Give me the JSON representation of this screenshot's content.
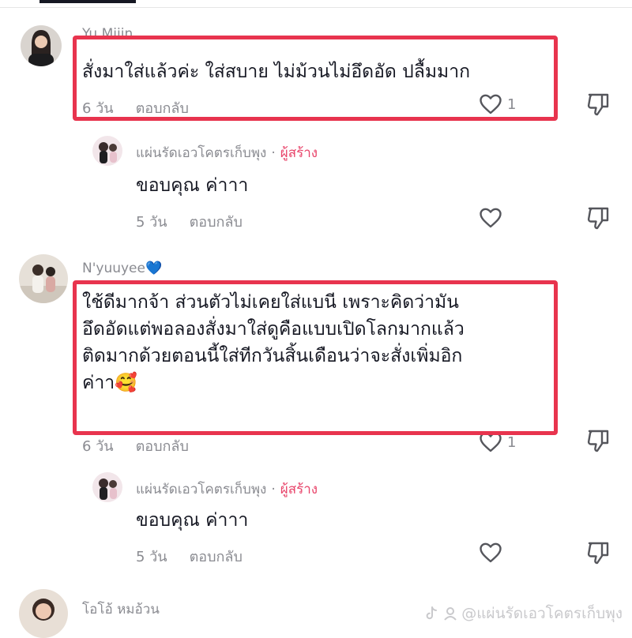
{
  "comments": [
    {
      "username": "Yu Miiin",
      "text_lines": [
        "สั่งมาใส่แล้วค่ะ ใส่สบาย ไม่ม้วนไม่อึดอัด ปลื้มมาก"
      ],
      "time": "6 วัน",
      "reply_label": "ตอบกลับ",
      "like_count": "1",
      "reply": {
        "username": "แผ่นรัดเอวโคตรเก็บพุง",
        "separator": "·",
        "badge": "ผู้สร้าง",
        "text": "ขอบคุณ ค่าาา",
        "time": "5 วัน",
        "reply_label": "ตอบกลับ"
      }
    },
    {
      "username": "N'yuuyee",
      "username_emoji": "💙",
      "text_lines": [
        "ใช้ดีมากจ้า ส่วนตัวไม่เคยใส่แบนี เพราะคิดว่ามัน",
        "อึดอัดแต่พอลองสั่งมาใส่ดูคือแบบเปิดโลกมากแล้ว",
        "ติดมากด้วยตอนนี้ใส่ทีกวันสิ้นเดือนว่าจะสั่งเพิ่มอิก",
        "ค่าา"
      ],
      "text_emoji": "🥰",
      "time": "6 วัน",
      "reply_label": "ตอบกลับ",
      "like_count": "1",
      "reply": {
        "username": "แผ่นรัดเอวโคตรเก็บพุง",
        "separator": "·",
        "badge": "ผู้สร้าง",
        "text": "ขอบคุณ ค่าาา",
        "time": "5 วัน",
        "reply_label": "ตอบกลับ"
      }
    },
    {
      "username": "โอโอ้ หมอ้วน"
    }
  ],
  "watermark": {
    "text": "@แผ่นรัดเอวโคตรเก็บพุง",
    "icon": "tiktok-logo-icon"
  },
  "colors": {
    "highlight": "#e8344e",
    "creator_badge": "#e8446a",
    "secondary_text": "#8a8b91"
  }
}
